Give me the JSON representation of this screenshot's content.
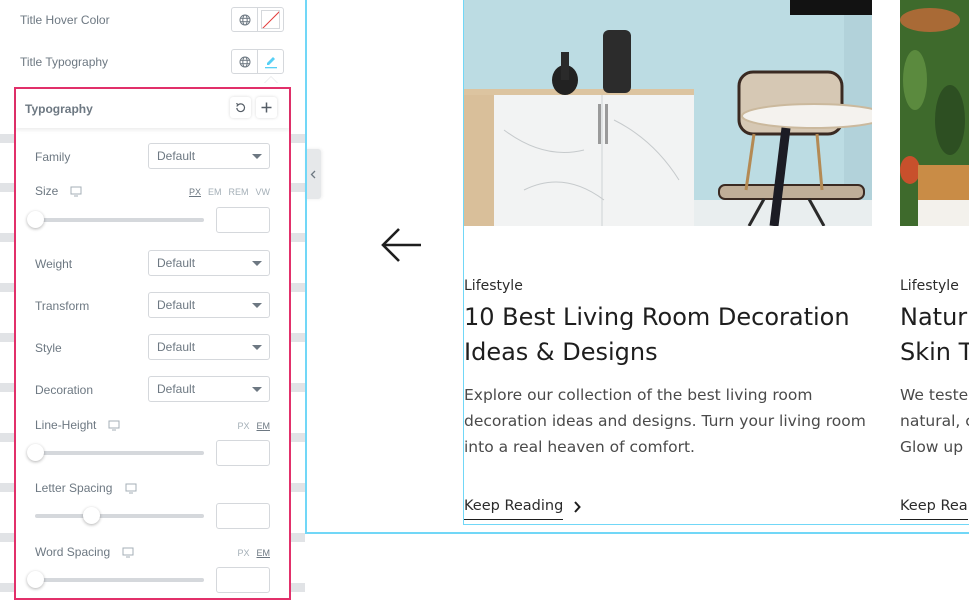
{
  "panel": {
    "title_hover_color": {
      "label": "Title Hover Color",
      "globe_icon": "globe-icon",
      "value": "none"
    },
    "title_typography": {
      "label": "Title Typography",
      "globe_icon": "globe-icon",
      "edit_icon": "pencil-icon"
    }
  },
  "typography": {
    "heading": "Typography",
    "reset_icon": "reset-icon",
    "add_icon": "plus-icon",
    "family": {
      "label": "Family",
      "value": "Default"
    },
    "size": {
      "label": "Size",
      "units": [
        "PX",
        "EM",
        "REM",
        "VW"
      ],
      "active_unit": "PX",
      "value": "",
      "slider_fraction": 0.0
    },
    "weight": {
      "label": "Weight",
      "value": "Default"
    },
    "transform": {
      "label": "Transform",
      "value": "Default"
    },
    "style": {
      "label": "Style",
      "value": "Default"
    },
    "decoration": {
      "label": "Decoration",
      "value": "Default"
    },
    "line_height": {
      "label": "Line-Height",
      "units": [
        "PX",
        "EM"
      ],
      "active_unit": "EM",
      "value": "",
      "slider_fraction": 0.0
    },
    "letter_spacing": {
      "label": "Letter Spacing",
      "value": "",
      "slider_fraction": 0.33
    },
    "word_spacing": {
      "label": "Word Spacing",
      "units": [
        "PX",
        "EM"
      ],
      "active_unit": "EM",
      "value": "",
      "slider_fraction": 0.0
    }
  },
  "colors": {
    "accent_popover_border": "#e2306a",
    "preview_outline": "#71d7f7",
    "edit_icon": "#58d0f5"
  },
  "preview": {
    "prev_arrow_icon": "arrow-left-icon",
    "cards": [
      {
        "category": "Lifestyle",
        "title_lines": [
          "10 Best Living Room Decoration",
          "Ideas & Designs"
        ],
        "excerpt_lines": [
          "Explore our collection of the best living room",
          "decoration ideas and designs. Turn your living room",
          "into a real heaven of comfort."
        ],
        "link": "Keep Reading"
      },
      {
        "category": "Lifestyle",
        "title_lines": [
          "Natur",
          "Skin T"
        ],
        "excerpt_lines": [
          "We teste",
          "natural, c",
          "Glow up"
        ],
        "link": "Keep Rea"
      }
    ]
  }
}
